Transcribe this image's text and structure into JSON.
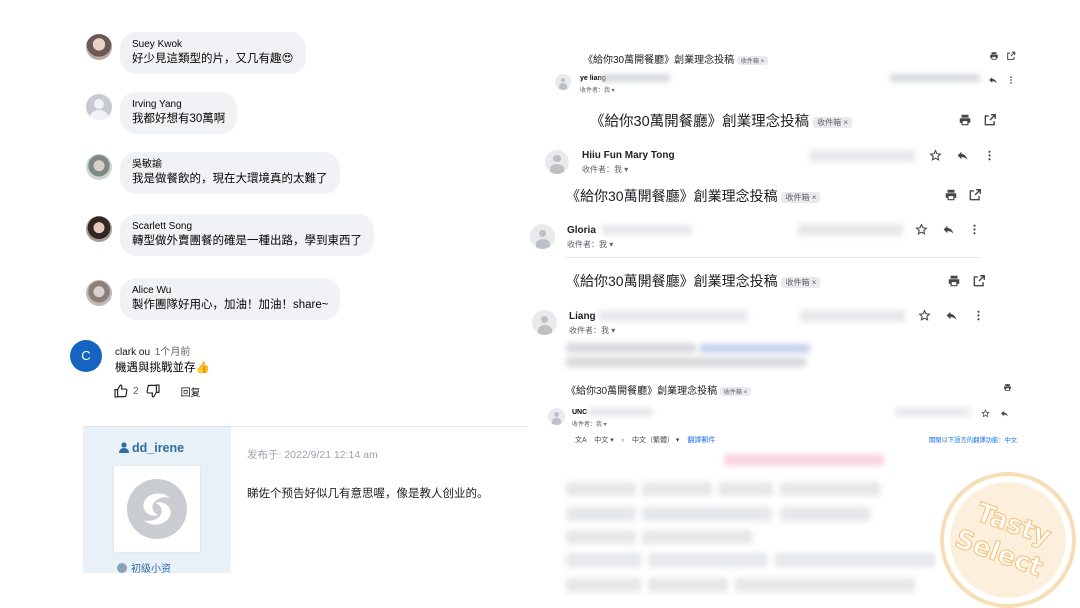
{
  "facebook_comments": [
    {
      "name": "Suey Kwok",
      "text": "好少見這類型的片，又几有趣😍"
    },
    {
      "name": "Irving Yang",
      "text": "我都好想有30萬啊"
    },
    {
      "name": "吳敏諭",
      "text": "我是做餐飲的，現在大環境真的太難了"
    },
    {
      "name": "Scarlett Song",
      "text": "轉型做外賣團餐的確是一種出路，學到東西了"
    },
    {
      "name": "Alice Wu",
      "text": "製作團隊好用心，加油！加油！share~"
    }
  ],
  "youtube_comment": {
    "avatar_letter": "C",
    "author": "clark ou",
    "ago": "1个月前",
    "text": "機遇與挑戰並存👍",
    "likes": "2",
    "reply_label": "回复"
  },
  "forum_post": {
    "username": "dd_irene",
    "date": "发布于: 2022/9/21    12:14 am",
    "text": "睇佐个预告好似几有意思喔，像是教人创业的。",
    "rank": "初级小资"
  },
  "emails": {
    "subject": "《給你30萬開餐廳》創業理念投稿",
    "inbox_tag": "收件箱 ×",
    "to_me": "收件者：我 ▾",
    "senders": [
      "ye liang",
      "Hiiu Fun Mary Tong",
      "Gloria",
      "Liang",
      "UNC"
    ],
    "translate_from": "中文 ▾",
    "translate_arrow": "›",
    "translate_to": "中文（繁體） ▾",
    "translate_link": "翻譯郵件",
    "translate_off": "關閉以下語言的翻譯功能：中文"
  },
  "stamp": {
    "line1": "Tasty",
    "line2": "Select"
  },
  "colors": {
    "youtube_avatar": "#1565c0",
    "forum_link": "#2e6ca4",
    "bubble": "#f0f2f5",
    "stamp": "#f3c27a"
  }
}
